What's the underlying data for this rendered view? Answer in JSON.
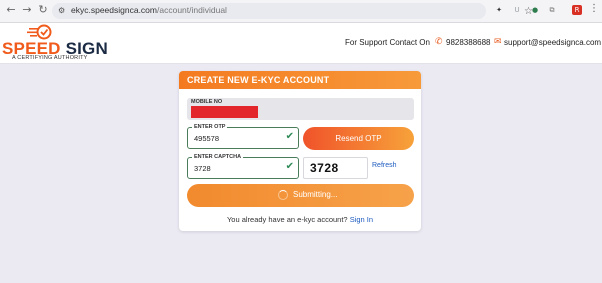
{
  "browser": {
    "url_host": "ekyc.speedsignca.com",
    "url_path": "/account/individual",
    "back_icon": "←",
    "forward_icon": "→",
    "reload_icon": "↻",
    "site_info_icon": "⚙",
    "star_icon": "☆",
    "extensions": [
      {
        "name": "extension-black-icon",
        "glyph": "✦",
        "color": "#333333"
      },
      {
        "name": "extension-u-icon",
        "glyph": "U",
        "color": "#9aa0a6"
      },
      {
        "name": "extension-green-icon",
        "glyph": "●",
        "color": "#2e7d4f"
      },
      {
        "name": "extensions-puzzle-icon",
        "glyph": "⧉",
        "color": "#777777"
      },
      {
        "name": "extension-red-icon",
        "glyph": "R",
        "color": "#d93025"
      }
    ],
    "more_icon": "⋮"
  },
  "site": {
    "logo_speed": "SPEED",
    "logo_sign": "SIGN",
    "logo_subtitle": "A CERTIFYING AUTHORITY",
    "support_label": "For Support Contact On",
    "phone": "9828388688",
    "email": "support@speedsignca.com",
    "brand_color": "#f05a1a"
  },
  "form": {
    "title": "CREATE NEW E-KYC ACCOUNT",
    "mobile_label": "MOBILE NO",
    "otp_label": "ENTER OTP",
    "otp_value": "495578",
    "resend_label": "Resend OTP",
    "captcha_label": "ENTER CAPTCHA",
    "captcha_value": "3728",
    "captcha_image_text": "3728",
    "refresh_label": "Refresh",
    "submit_label": "Submitting...",
    "footer_text": "You already have an e-kyc account?",
    "signin_label": "Sign In"
  }
}
